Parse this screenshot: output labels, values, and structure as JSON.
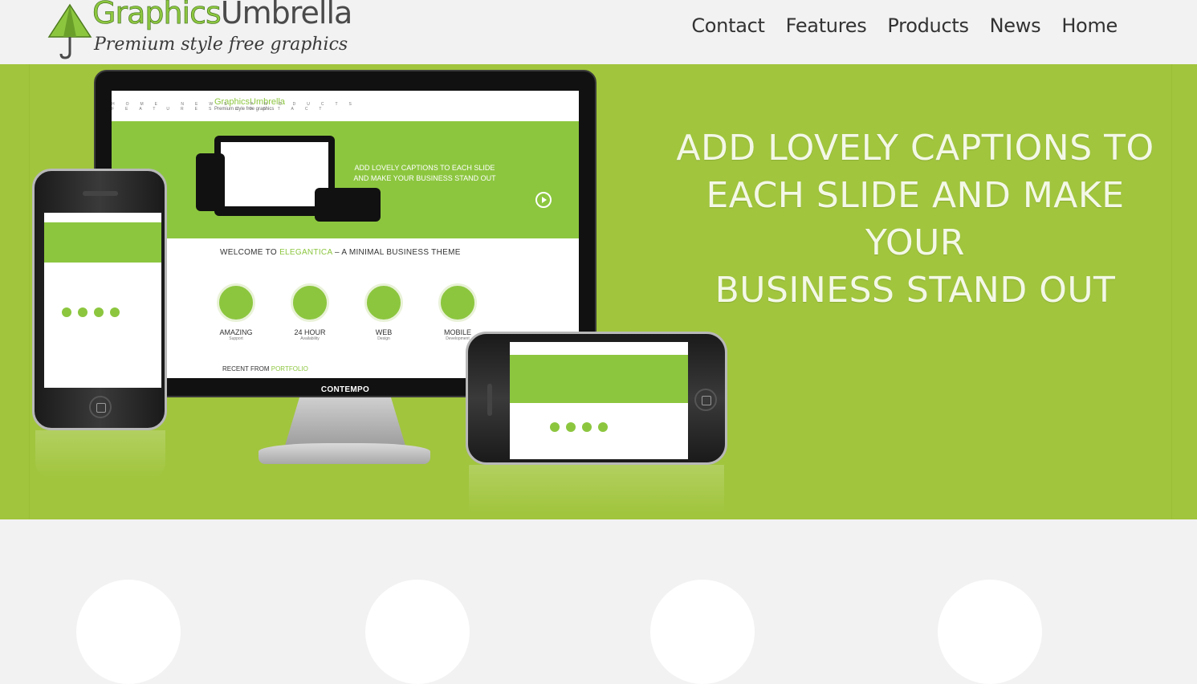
{
  "header": {
    "logo": {
      "title_part1": "Graphics",
      "title_part2": "Umbrella",
      "tagline": "Premium style free graphics"
    },
    "nav": [
      {
        "label": "Contact"
      },
      {
        "label": "Features"
      },
      {
        "label": "Products"
      },
      {
        "label": "News"
      },
      {
        "label": "Home"
      }
    ]
  },
  "slider": {
    "caption_lines": [
      "ADD LOVELY CAPTIONS TO",
      "EACH SLIDE AND MAKE YOUR",
      "BUSINESS STAND OUT"
    ],
    "monitor_site": {
      "logo": "GraphicsUmbrella",
      "tagline": "Premium style free graphics",
      "nav": "HOME NEWS PRODUCTS FEATURES CONTACT",
      "hero_caption": "ADD LOVELY CAPTIONS TO EACH SLIDE AND MAKE YOUR BUSINESS STAND OUT",
      "welcome_prefix": "WELCOME TO ",
      "welcome_brand": "ELEGANTICA",
      "welcome_suffix": " – A MINIMAL BUSINESS THEME",
      "features": [
        {
          "title": "AMAZING",
          "sub": "Support"
        },
        {
          "title": "24 HOUR",
          "sub": "Availability"
        },
        {
          "title": "WEB",
          "sub": "Design"
        },
        {
          "title": "MOBILE",
          "sub": "Development"
        }
      ],
      "recent_prefix": "RECENT FROM ",
      "recent_highlight": "PORTFOLIO",
      "brand": "CONTEMPO"
    }
  },
  "colors": {
    "accent_green": "#a1c53d",
    "site_green": "#8cc63f",
    "background": "#f2f2f2"
  }
}
